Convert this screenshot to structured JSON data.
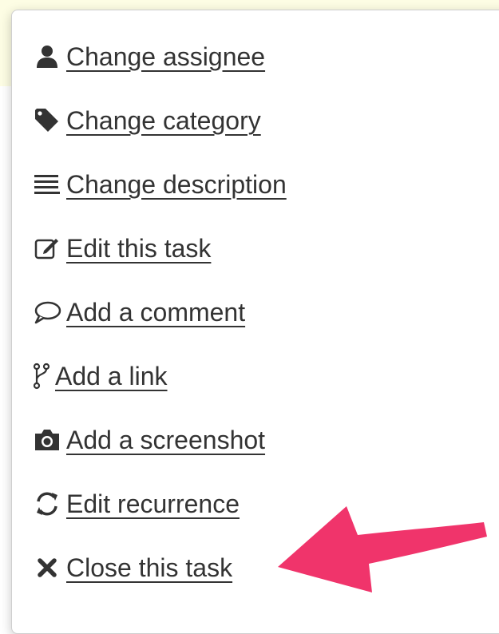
{
  "menu": {
    "items": [
      {
        "label": "Change assignee",
        "icon": "user-icon"
      },
      {
        "label": "Change category",
        "icon": "tag-icon"
      },
      {
        "label": "Change description",
        "icon": "align-left-icon"
      },
      {
        "label": "Edit this task",
        "icon": "edit-icon"
      },
      {
        "label": "Add a comment",
        "icon": "comment-icon"
      },
      {
        "label": "Add a link",
        "icon": "code-fork-icon"
      },
      {
        "label": "Add a screenshot",
        "icon": "camera-icon"
      },
      {
        "label": "Edit recurrence",
        "icon": "refresh-icon"
      },
      {
        "label": "Close this task",
        "icon": "close-icon"
      }
    ]
  },
  "annotation": {
    "arrow_color": "#f0346b"
  },
  "colors": {
    "text": "#333333",
    "icon": "#333333",
    "background_highlight": "#fdfde4"
  }
}
